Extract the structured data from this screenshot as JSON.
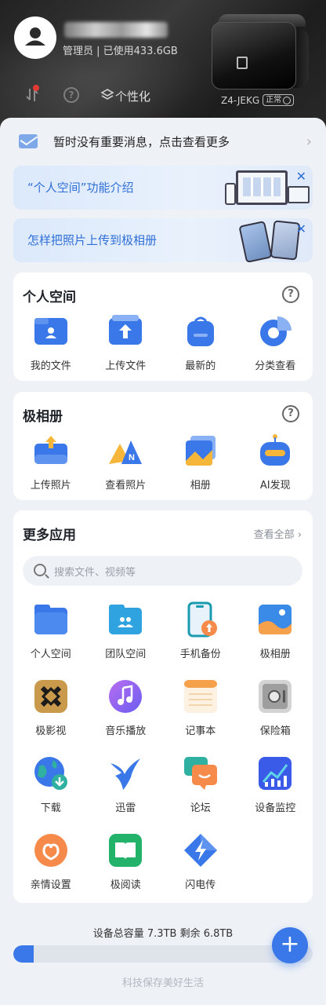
{
  "header": {
    "user_sub": "管理员 | 已使用433.6GB",
    "personalize_label": "个性化",
    "device_name": "Z4-JEKG",
    "device_status": "正常"
  },
  "notice": {
    "text": "暂时没有重要消息，点击查看更多"
  },
  "banners": [
    {
      "text": "“个人空间”功能介绍"
    },
    {
      "text": "怎样把照片上传到极相册"
    }
  ],
  "personal_space": {
    "title": "个人空间",
    "items": [
      {
        "label": "我的文件",
        "icon": "my-files-icon"
      },
      {
        "label": "上传文件",
        "icon": "upload-file-icon"
      },
      {
        "label": "最新的",
        "icon": "recent-icon"
      },
      {
        "label": "分类查看",
        "icon": "category-icon"
      }
    ]
  },
  "album": {
    "title": "极相册",
    "items": [
      {
        "label": "上传照片",
        "icon": "upload-photo-icon"
      },
      {
        "label": "查看照片",
        "icon": "view-photo-icon"
      },
      {
        "label": "相册",
        "icon": "album-icon"
      },
      {
        "label": "AI发现",
        "icon": "ai-discover-icon"
      }
    ]
  },
  "more_apps": {
    "title": "更多应用",
    "view_all": "查看全部",
    "search_placeholder": "搜索文件、视频等",
    "apps": [
      {
        "label": "个人空间",
        "icon": "personal-space-icon"
      },
      {
        "label": "团队空间",
        "icon": "team-space-icon"
      },
      {
        "label": "手机备份",
        "icon": "phone-backup-icon"
      },
      {
        "label": "极相册",
        "icon": "photo-album-icon"
      },
      {
        "label": "极影视",
        "icon": "video-icon"
      },
      {
        "label": "音乐播放",
        "icon": "music-icon"
      },
      {
        "label": "记事本",
        "icon": "notepad-icon"
      },
      {
        "label": "保险箱",
        "icon": "safe-icon"
      },
      {
        "label": "下载",
        "icon": "download-icon"
      },
      {
        "label": "迅雷",
        "icon": "xunlei-icon"
      },
      {
        "label": "论坛",
        "icon": "forum-icon"
      },
      {
        "label": "设备监控",
        "icon": "monitor-icon"
      },
      {
        "label": "亲情设置",
        "icon": "family-icon"
      },
      {
        "label": "极阅读",
        "icon": "reader-icon"
      },
      {
        "label": "闪电传",
        "icon": "lightning-transfer-icon"
      }
    ]
  },
  "storage": {
    "text": "设备总容量 7.3TB  剩余 6.8TB",
    "used_fraction": 0.068
  },
  "footer": {
    "slogan": "科技保存美好生活"
  },
  "colors": {
    "accent": "#3a77e8",
    "header_bg": "#222222",
    "page_bg": "#eef1f6"
  }
}
